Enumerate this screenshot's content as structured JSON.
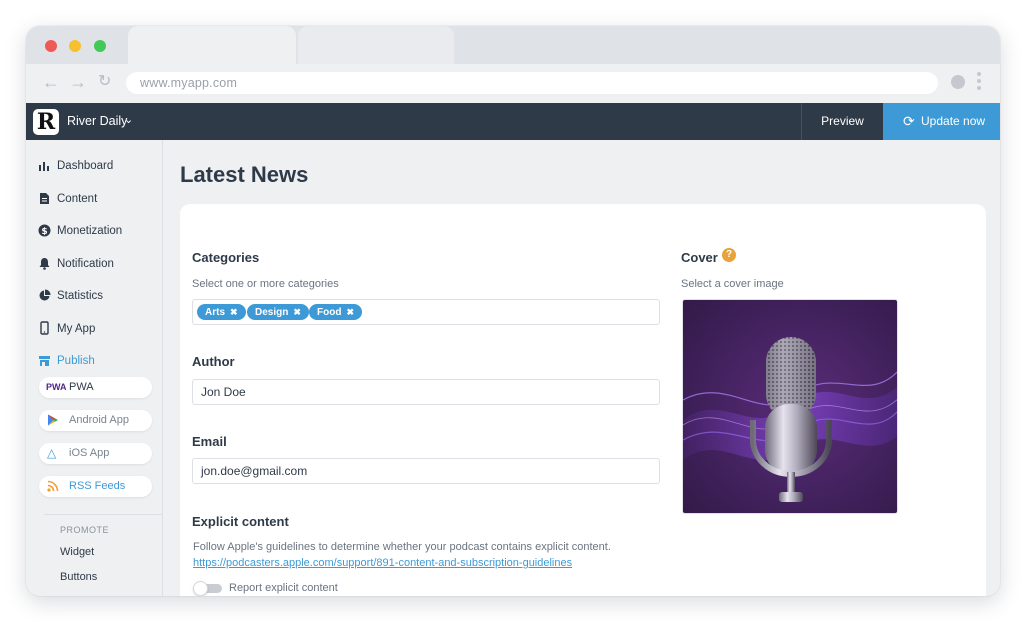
{
  "browser": {
    "url": "www.myapp.com"
  },
  "header": {
    "app_name": "River Daily",
    "logo_letter": "R",
    "preview_label": "Preview",
    "update_label": "Update now"
  },
  "sidebar": {
    "items": [
      {
        "label": "Dashboard",
        "icon": "bar-chart-icon"
      },
      {
        "label": "Content",
        "icon": "document-icon"
      },
      {
        "label": "Monetization",
        "icon": "dollar-icon"
      },
      {
        "label": "Notification",
        "icon": "bell-icon"
      },
      {
        "label": "Statistics",
        "icon": "pie-chart-icon"
      },
      {
        "label": "My App",
        "icon": "phone-icon"
      },
      {
        "label": "Publish",
        "icon": "store-icon"
      }
    ],
    "publish_targets": [
      {
        "label": "PWA",
        "icon": "pwa-icon"
      },
      {
        "label": "Android App",
        "icon": "play-store-icon"
      },
      {
        "label": "iOS App",
        "icon": "app-store-icon"
      },
      {
        "label": "RSS Feeds",
        "icon": "rss-icon"
      }
    ],
    "promote_heading": "PROMOTE",
    "promote_items": [
      "Widget",
      "Buttons"
    ]
  },
  "main": {
    "title": "Latest News",
    "categories": {
      "label": "Categories",
      "help": "Select one or more categories",
      "tags": [
        "Arts",
        "Design",
        "Food"
      ]
    },
    "author": {
      "label": "Author",
      "value": "Jon Doe"
    },
    "email": {
      "label": "Email",
      "value": "jon.doe@gmail.com"
    },
    "explicit": {
      "label": "Explicit content",
      "help": "Follow Apple's guidelines to determine whether your podcast contains explicit content.",
      "link": "https://podcasters.apple.com/support/891-content-and-subscription-guidelines",
      "toggle_label": "Report explicit content"
    },
    "cover": {
      "label": "Cover",
      "help": "Select a cover image",
      "help_badge": "?"
    }
  },
  "colors": {
    "accent": "#3d9ad6",
    "header_bg": "#2f3a48",
    "help_badge": "#e8a33a",
    "cover_bg": "#3a1f52"
  }
}
